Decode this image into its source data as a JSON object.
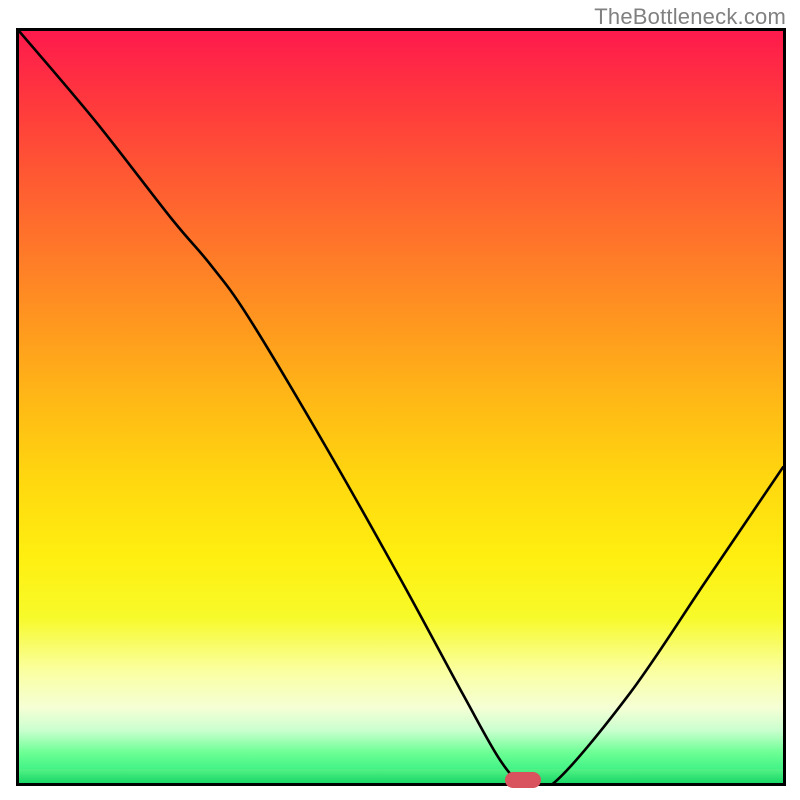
{
  "watermark": "TheBottleneck.com",
  "chart_data": {
    "type": "line",
    "title": "",
    "xlabel": "",
    "ylabel": "",
    "xlim": [
      0,
      100
    ],
    "ylim": [
      0,
      100
    ],
    "gradient_stops": [
      {
        "t": 0.0,
        "color": "#ff1a4d"
      },
      {
        "t": 0.1,
        "color": "#ff3a3c"
      },
      {
        "t": 0.2,
        "color": "#ff5b32"
      },
      {
        "t": 0.3,
        "color": "#ff7b28"
      },
      {
        "t": 0.4,
        "color": "#ff9b1e"
      },
      {
        "t": 0.5,
        "color": "#ffbb15"
      },
      {
        "t": 0.6,
        "color": "#ffd80f"
      },
      {
        "t": 0.7,
        "color": "#ffef10"
      },
      {
        "t": 0.78,
        "color": "#f7fa2a"
      },
      {
        "t": 0.85,
        "color": "#faffa0"
      },
      {
        "t": 0.9,
        "color": "#f5ffd5"
      },
      {
        "t": 0.93,
        "color": "#caffcf"
      },
      {
        "t": 0.96,
        "color": "#6bff94"
      },
      {
        "t": 1.0,
        "color": "#20e87a"
      }
    ],
    "series": [
      {
        "name": "curve",
        "x": [
          0,
          10,
          20,
          25,
          30,
          40,
          50,
          58,
          63,
          66,
          70,
          80,
          90,
          100
        ],
        "y": [
          100,
          88,
          75,
          69,
          62,
          45,
          27,
          12,
          3,
          0,
          0,
          12,
          27,
          42
        ]
      }
    ],
    "marker": {
      "x": 66,
      "y": 0,
      "color": "#d9535e"
    }
  }
}
